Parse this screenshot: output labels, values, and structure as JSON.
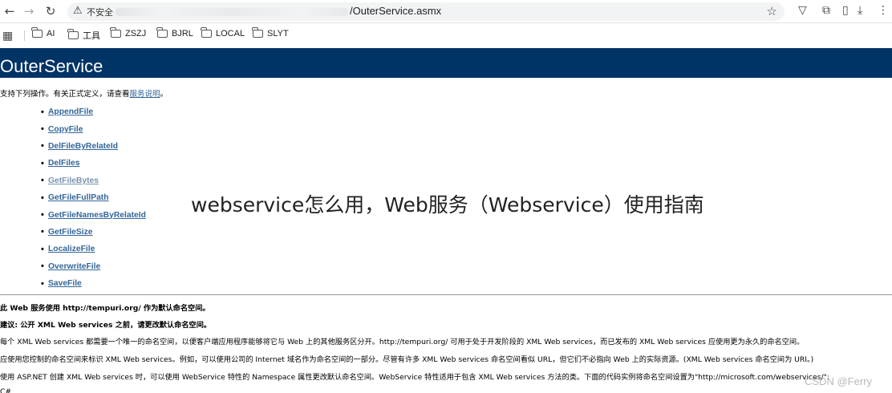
{
  "browser": {
    "back_icon": "←",
    "forward_icon": "→",
    "reload_icon": "↻",
    "warning_icon": "⚠",
    "security_label": "不安全",
    "url_visible": "/OuterService.asmx",
    "star_icon": "☆",
    "extensions_icon": "▽",
    "puzzle_icon": "⧉",
    "sidebar_icon": "▯",
    "download_icon": "⤓",
    "menu_icon": "⋮"
  },
  "bookmarks": {
    "apps_icon": "▦",
    "items": [
      {
        "label": "AI"
      },
      {
        "label": "工具"
      },
      {
        "label": "ZSZJ"
      },
      {
        "label": "BJRL"
      },
      {
        "label": "LOCAL"
      },
      {
        "label": "SLYT"
      }
    ]
  },
  "page": {
    "title": "OuterService",
    "intro_prefix": "支持下列操作。有关正式定义，请查看",
    "intro_link": "服务说明",
    "intro_suffix": "。",
    "operations": [
      {
        "name": "AppendFile",
        "visited": false
      },
      {
        "name": "CopyFile",
        "visited": false
      },
      {
        "name": "DelFileByRelateId",
        "visited": false
      },
      {
        "name": "DelFiles",
        "visited": false
      },
      {
        "name": "GetFileBytes",
        "visited": true
      },
      {
        "name": "GetFileFullPath",
        "visited": false
      },
      {
        "name": "GetFileNamesByRelateId",
        "visited": false
      },
      {
        "name": "GetFileSize",
        "visited": false
      },
      {
        "name": "LocalizeFile",
        "visited": false
      },
      {
        "name": "OverwriteFile",
        "visited": false
      },
      {
        "name": "SaveFile",
        "visited": false
      }
    ],
    "namespace_heading": "此 Web 服务使用 http://tempuri.org/ 作为默认命名空间。",
    "recommendation_heading": "建议: 公开 XML Web services 之前，请更改默认命名空间。",
    "para1": "每个 XML Web services 都需要一个唯一的命名空间，以便客户端应用程序能够将它与 Web 上的其他服务区分开。http://tempuri.org/ 可用于处于开发阶段的 XML Web services，而已发布的 XML Web services 应使用更为永久的命名空间。",
    "para2": "应使用您控制的命名空间来标识 XML Web services。例如，可以使用公司的 Internet 域名作为命名空间的一部分。尽管有许多 XML Web services 命名空间看似 URL，但它们不必指向 Web 上的实际资源。(XML Web services 命名空间为 URI。)",
    "para3": "使用 ASP.NET 创建 XML Web services 时，可以使用 WebService 特性的 Namespace 属性更改默认命名空间。WebService 特性适用于包含 XML Web services 方法的类。下面的代码实例将命名空间设置为\"http://microsoft.com/webservices/\":",
    "para4": "C#"
  },
  "overlay": {
    "title": "webservice怎么用，Web服务（Webservice）使用指南",
    "credit": "CSDN @Ferry"
  }
}
